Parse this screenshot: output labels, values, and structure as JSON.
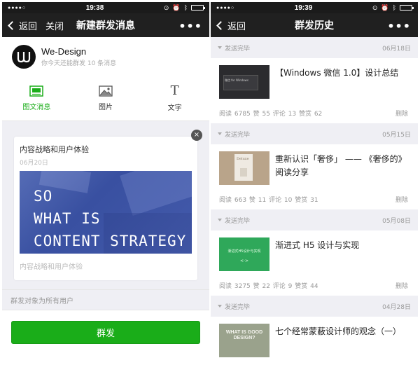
{
  "left": {
    "status": {
      "time": "19:38"
    },
    "nav": {
      "back": "返回",
      "close": "关闭",
      "title": "新建群发消息",
      "more": "•••"
    },
    "account": {
      "name": "We-Design",
      "subtitle": "你今天还能群发 10 条消息"
    },
    "type_tabs": [
      {
        "label": "图文消息",
        "icon": "article-icon",
        "active": true
      },
      {
        "label": "图片",
        "icon": "image-icon",
        "active": false
      },
      {
        "label": "文字",
        "icon": "text-icon",
        "active": false
      }
    ],
    "card": {
      "title": "内容战略和用户体验",
      "date": "06月20日",
      "image_lines": [
        "SO",
        "WHAT IS",
        "CONTENT STRATEGY"
      ],
      "digest": "内容战略和用户体验",
      "close": "×"
    },
    "target": "群发对象为所有用户",
    "send": "群发"
  },
  "right": {
    "status": {
      "time": "19:39"
    },
    "nav": {
      "back": "返回",
      "title": "群发历史",
      "more": "•••"
    },
    "items": [
      {
        "status": "发送完毕",
        "date": "06月18日",
        "title": "【Windows 微信 1.0】设计总结",
        "stats": "阅读 6785   赞 55   评论 13   赞赏 62",
        "delete": "删除",
        "thumb_text": "微信 for Windows"
      },
      {
        "status": "发送完毕",
        "date": "05月15日",
        "title": "重新认识「奢侈」 —— 《奢侈的》阅读分享",
        "stats": "阅读 663   赞 11   评论 10   赞赏 31",
        "delete": "删除",
        "thumb_text": "Deluxe"
      },
      {
        "status": "发送完毕",
        "date": "05月08日",
        "title": "渐进式 H5 设计与实现",
        "stats": "阅读 3275   赞 22   评论 9   赞赏 44",
        "delete": "删除",
        "thumb_text": "渐进式H5设计与实现"
      },
      {
        "status": "发送完毕",
        "date": "04月28日",
        "title": "七个经常蒙蔽设计师的观念（一）",
        "stats": "",
        "delete": "",
        "thumb_text": "WHAT IS GOOD DESIGN?"
      }
    ]
  },
  "colors": {
    "accent_green": "#1aad19",
    "nav_bg": "#202020",
    "page_bg": "#efeff4"
  }
}
